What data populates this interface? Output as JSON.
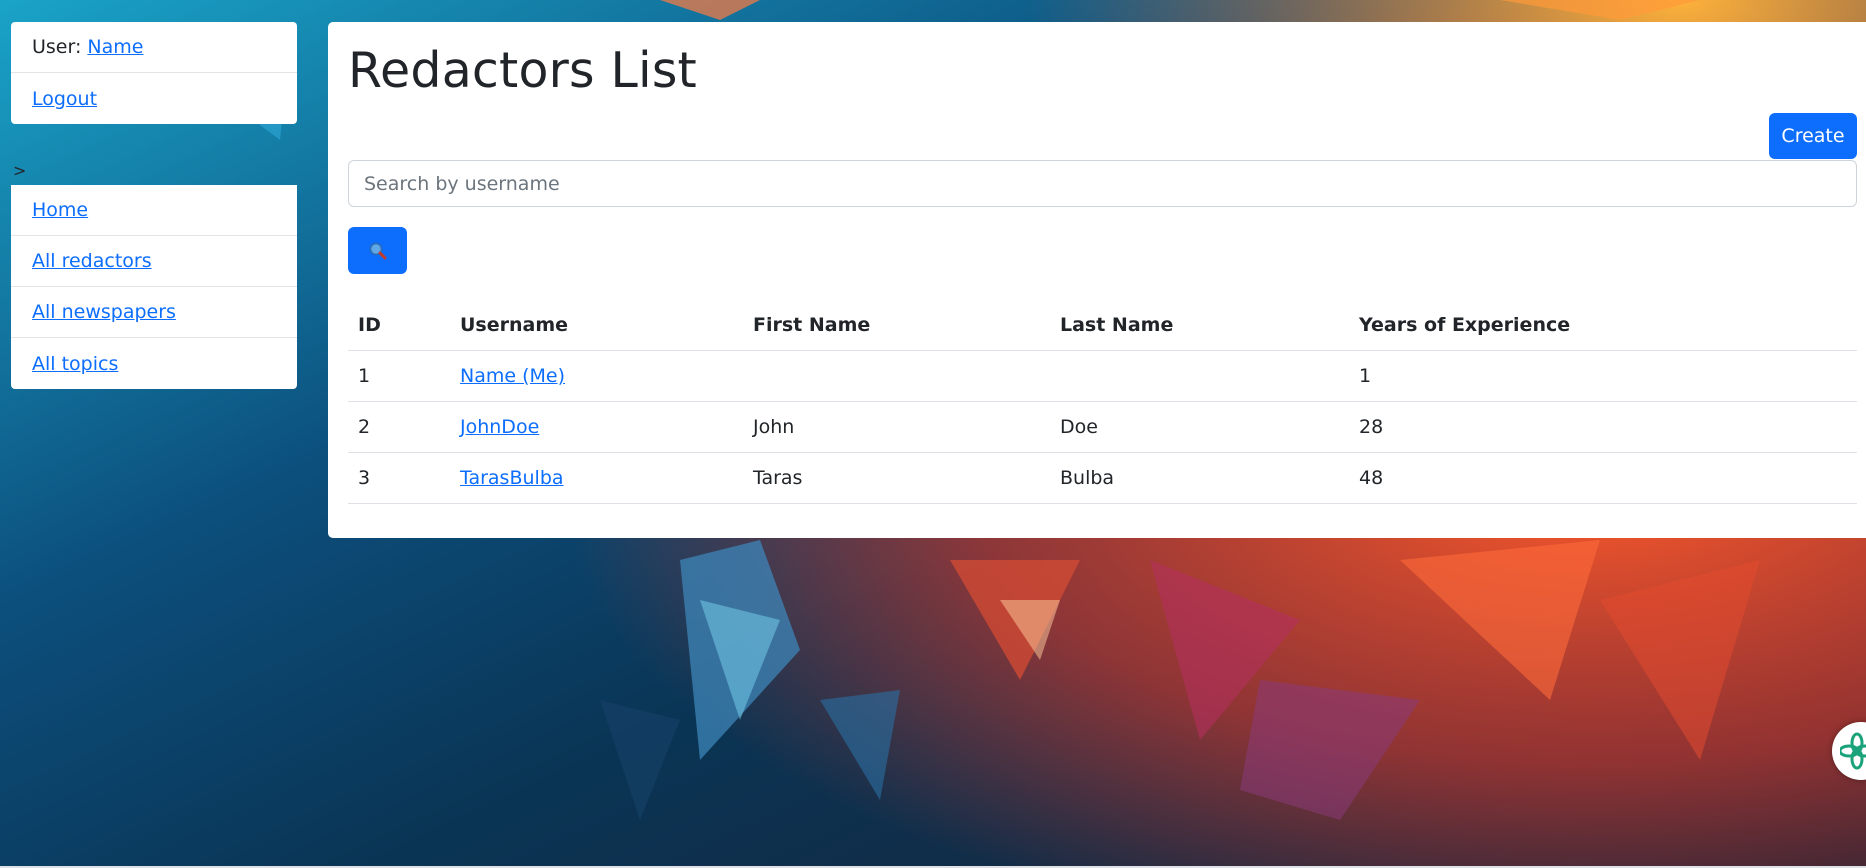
{
  "user_card": {
    "user_prefix": "User:",
    "user_name": "Name",
    "logout_label": "Logout"
  },
  "nav": {
    "toggle_symbol": ">",
    "items": [
      {
        "label": "Home"
      },
      {
        "label": "All redactors"
      },
      {
        "label": "All newspapers"
      },
      {
        "label": "All topics"
      }
    ]
  },
  "page": {
    "title": "Redactors List",
    "create_label": "Create",
    "search_placeholder": "Search by username",
    "search_icon": "magnifier-icon"
  },
  "table": {
    "headers": {
      "id": "ID",
      "username": "Username",
      "first_name": "First Name",
      "last_name": "Last Name",
      "years": "Years of Experience"
    },
    "rows": [
      {
        "id": "1",
        "username": "Name (Me)",
        "first_name": "",
        "last_name": "",
        "years": "1"
      },
      {
        "id": "2",
        "username": "JohnDoe",
        "first_name": "John",
        "last_name": "Doe",
        "years": "28"
      },
      {
        "id": "3",
        "username": "TarasBulba",
        "first_name": "Taras",
        "last_name": "Bulba",
        "years": "48"
      }
    ]
  },
  "floating_widget": {
    "icon": "flower-logo-icon"
  },
  "colors": {
    "primary": "#0d6efd",
    "link": "#0d6efd",
    "panel": "#ffffff",
    "text": "#212529"
  }
}
